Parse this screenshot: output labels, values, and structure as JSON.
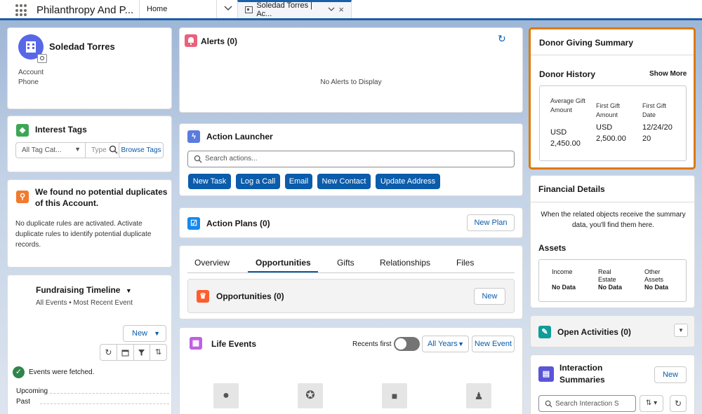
{
  "topbar": {
    "app_name": "Philanthropy And P...",
    "home_tab": "Home",
    "record_tab": "Soledad Torres | Ac..."
  },
  "account": {
    "name": "Soledad Torres",
    "field1": "Account",
    "field2": "Phone"
  },
  "interest_tags": {
    "title": "Interest Tags",
    "category_placeholder": "All Tag Cat...",
    "type_placeholder": "Type",
    "browse_label": "Browse Tags"
  },
  "duplicates": {
    "title": "We found no potential duplicates of this Account.",
    "body": "No duplicate rules are activated. Activate duplicate rules to identify potential duplicate records."
  },
  "timeline": {
    "title": "Fundraising Timeline",
    "filter": "All Events • Most Recent Event",
    "new_label": "New",
    "status": "Events were fetched.",
    "upcoming": "Upcoming",
    "past": "Past"
  },
  "alerts": {
    "title": "Alerts (0)",
    "empty": "No Alerts to Display"
  },
  "action_launcher": {
    "title": "Action Launcher",
    "search_placeholder": "Search actions...",
    "buttons": [
      "New Task",
      "Log a Call",
      "Email",
      "New Contact",
      "Update Address"
    ]
  },
  "action_plans": {
    "title": "Action Plans (0)",
    "new_label": "New Plan"
  },
  "tabs": {
    "items": [
      "Overview",
      "Opportunities",
      "Gifts",
      "Relationships",
      "Files"
    ],
    "active": "Opportunities"
  },
  "opportunities": {
    "title": "Opportunities (0)",
    "new_label": "New"
  },
  "life_events": {
    "title": "Life Events",
    "recents_label": "Recents first",
    "years_label": "All Years",
    "new_label": "New Event"
  },
  "donor_summary": {
    "title": "Donor Giving Summary",
    "history_title": "Donor History",
    "show_more": "Show More",
    "avg_label": "Average Gift Amount",
    "avg_value": "USD 2,450.00",
    "first_amount_label": "First Gift Amount",
    "first_amount_value": "USD 2,500.00",
    "first_date_label": "First Gift Date",
    "first_date_value": "12/24/2020"
  },
  "financial": {
    "title": "Financial Details",
    "body": "When the related objects receive the summary data, you'll find them here.",
    "assets_title": "Assets",
    "income_label": "Income",
    "income_value": "No Data",
    "real_estate_label": "Real Estate",
    "real_estate_value": "No Data",
    "other_label": "Other Assets",
    "other_value": "No Data"
  },
  "open_activities": {
    "title": "Open Activities (0)"
  },
  "interaction": {
    "title": "Interaction Summaries",
    "new_label": "New",
    "search_placeholder": "Search Interaction S"
  },
  "colors": {
    "brand_blue": "#0b5cab",
    "highlight_orange": "#dd7a01"
  }
}
